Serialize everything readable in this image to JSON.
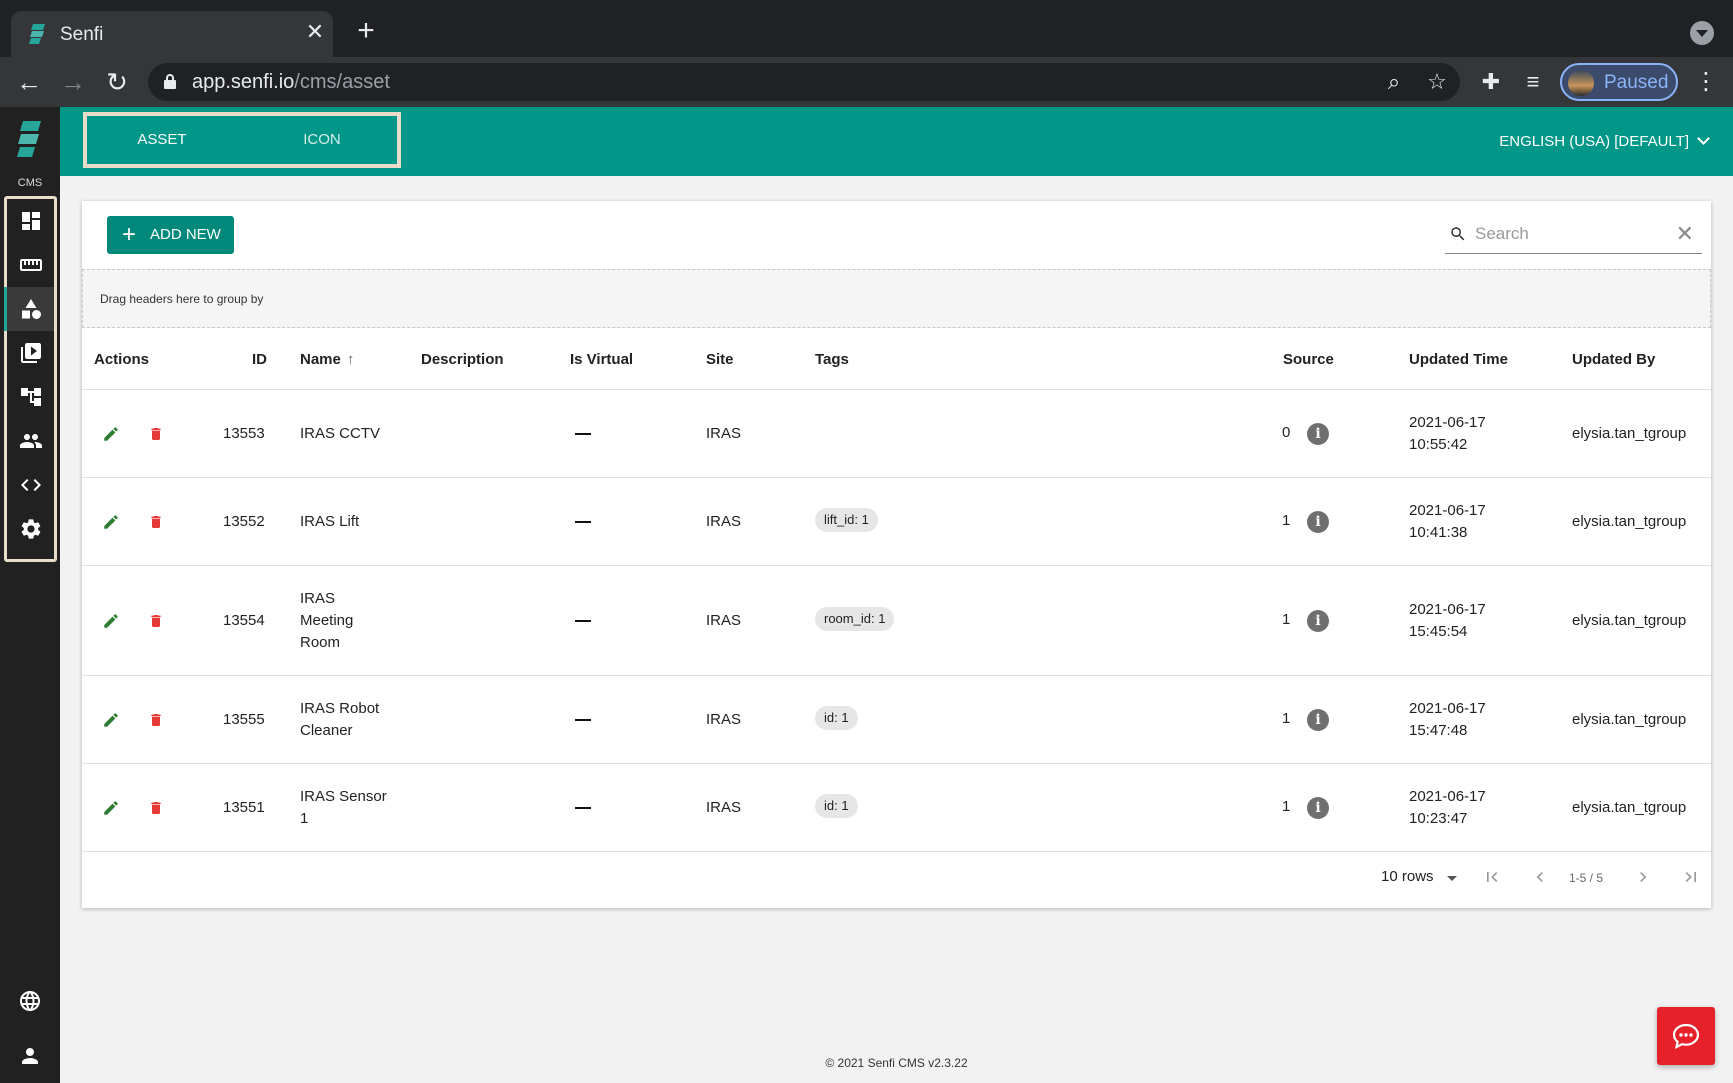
{
  "browser": {
    "tab_title": "Senfi",
    "url_host": "app.senfi.io",
    "url_path": "/cms/asset",
    "profile_label": "Paused"
  },
  "sidebar": {
    "cms_label": "CMS",
    "items": [
      {
        "icon": "dashboard-icon"
      },
      {
        "icon": "ruler-icon"
      },
      {
        "icon": "shapes-icon",
        "active": true
      },
      {
        "icon": "media-library-icon"
      },
      {
        "icon": "hierarchy-icon"
      },
      {
        "icon": "users-icon"
      },
      {
        "icon": "code-icon"
      },
      {
        "icon": "settings-icon"
      }
    ]
  },
  "header": {
    "tabs": [
      {
        "label": "ASSET"
      },
      {
        "label": "ICON"
      }
    ],
    "language": "ENGLISH (USA) [DEFAULT]"
  },
  "toolbar": {
    "add_label": "ADD NEW",
    "search_placeholder": "Search"
  },
  "groupby_hint": "Drag headers here to group by",
  "table": {
    "columns": {
      "actions": "Actions",
      "id": "ID",
      "name": "Name",
      "description": "Description",
      "is_virtual": "Is Virtual",
      "site": "Site",
      "tags": "Tags",
      "source": "Source",
      "updated_time": "Updated Time",
      "updated_by": "Updated By"
    },
    "rows": [
      {
        "id": "13553",
        "name": "IRAS CCTV",
        "site": "IRAS",
        "tag": "",
        "source": "0",
        "date": "2021-06-17",
        "time": "10:55:42",
        "by": "elysia.tan_tgroup"
      },
      {
        "id": "13552",
        "name": "IRAS Lift",
        "site": "IRAS",
        "tag": "lift_id: 1",
        "source": "1",
        "date": "2021-06-17",
        "time": "10:41:38",
        "by": "elysia.tan_tgroup"
      },
      {
        "id": "13554",
        "name": "IRAS Meeting Room",
        "site": "IRAS",
        "tag": "room_id: 1",
        "source": "1",
        "date": "2021-06-17",
        "time": "15:45:54",
        "by": "elysia.tan_tgroup"
      },
      {
        "id": "13555",
        "name": "IRAS Robot Cleaner",
        "site": "IRAS",
        "tag": "id: 1",
        "source": "1",
        "date": "2021-06-17",
        "time": "15:47:48",
        "by": "elysia.tan_tgroup"
      },
      {
        "id": "13551",
        "name": "IRAS Sensor 1",
        "site": "IRAS",
        "tag": "id: 1",
        "source": "1",
        "date": "2021-06-17",
        "time": "10:23:47",
        "by": "elysia.tan_tgroup"
      }
    ]
  },
  "pagination": {
    "rows_label": "10 rows",
    "range_label": "1-5 / 5"
  },
  "footer": {
    "copyright": "© 2021 Senfi CMS v2.3.22"
  },
  "colors": {
    "header": "#009688",
    "primary_button": "#00897b",
    "edit": "#2e7d32",
    "delete": "#e53935",
    "chat": "#e62129"
  }
}
